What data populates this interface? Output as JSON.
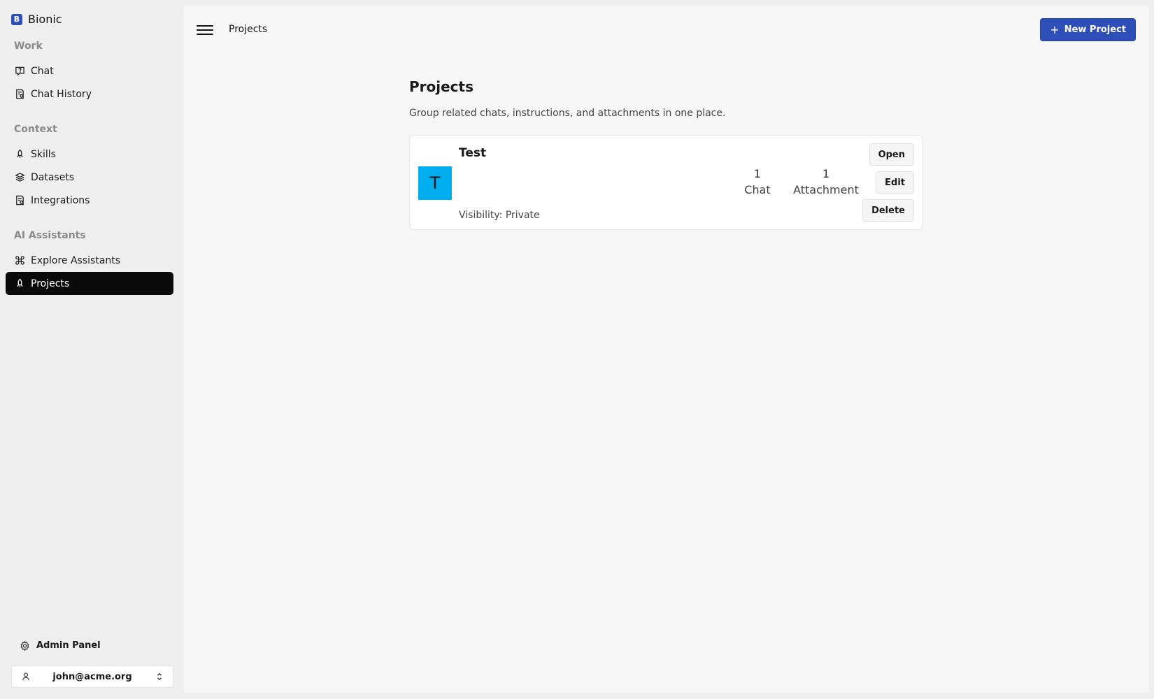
{
  "brand": {
    "logo_letter": "B",
    "name": "Bionic"
  },
  "sidebar": {
    "sections": [
      {
        "title": "Work"
      },
      {
        "title": "Context"
      },
      {
        "title": "AI Assistants"
      }
    ],
    "items": [
      {
        "label": "Chat",
        "icon": "chat-icon"
      },
      {
        "label": "Chat History",
        "icon": "history-icon"
      },
      {
        "label": "Skills",
        "icon": "rocket-icon"
      },
      {
        "label": "Datasets",
        "icon": "layers-icon"
      },
      {
        "label": "Integrations",
        "icon": "integrations-icon"
      },
      {
        "label": "Explore Assistants",
        "icon": "command-icon"
      },
      {
        "label": "Projects",
        "icon": "rocket-icon",
        "active": true
      }
    ],
    "admin_label": "Admin Panel",
    "user_email": "john@acme.org"
  },
  "header": {
    "title": "Projects",
    "new_button_label": "New Project"
  },
  "main": {
    "title": "Projects",
    "description": "Group related chats, instructions, and attachments in one place.",
    "projects": [
      {
        "avatar_letter": "T",
        "avatar_color": "#00adef",
        "name": "Test",
        "visibility": "Visibility: Private",
        "chat_count": "1",
        "chat_label": "Chat",
        "attachment_count": "1",
        "attachment_label": "Attachment",
        "buttons": {
          "open": "Open",
          "edit": "Edit",
          "delete": "Delete"
        }
      }
    ]
  },
  "colors": {
    "accent": "#2f4fb8",
    "active_nav": "#0a0a0a",
    "avatar": "#00adef"
  }
}
